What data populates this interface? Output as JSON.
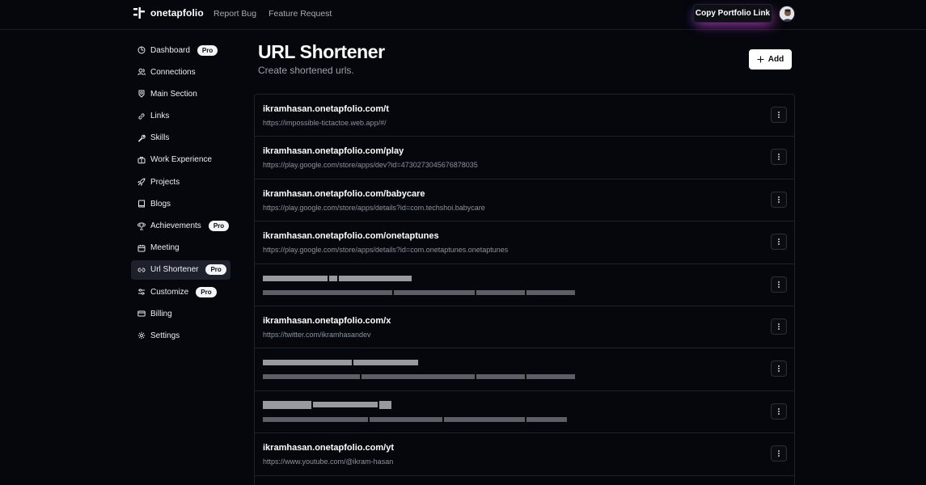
{
  "header": {
    "brand": "onetapfolio",
    "nav": [
      "Report Bug",
      "Feature Request"
    ],
    "copy_button": "Copy Portfolio Link",
    "accent_colors": [
      "#d63eba",
      "#604ad8"
    ]
  },
  "sidebar": {
    "items": [
      {
        "label": "Dashboard",
        "icon": "gauge-icon",
        "pro": true
      },
      {
        "label": "Connections",
        "icon": "users-icon",
        "pro": false
      },
      {
        "label": "Main Section",
        "icon": "badge-icon",
        "pro": false
      },
      {
        "label": "Links",
        "icon": "link-icon",
        "pro": false
      },
      {
        "label": "Skills",
        "icon": "wrench-icon",
        "pro": false
      },
      {
        "label": "Work Experience",
        "icon": "briefcase-icon",
        "pro": false
      },
      {
        "label": "Projects",
        "icon": "rocket-icon",
        "pro": false
      },
      {
        "label": "Blogs",
        "icon": "book-icon",
        "pro": false
      },
      {
        "label": "Achievements",
        "icon": "trophy-icon",
        "pro": true
      },
      {
        "label": "Meeting",
        "icon": "calendar-icon",
        "pro": false
      },
      {
        "label": "Url Shortener",
        "icon": "link-2-icon",
        "pro": true,
        "active": true
      },
      {
        "label": "Customize",
        "icon": "sliders-icon",
        "pro": true
      },
      {
        "label": "Billing",
        "icon": "credit-card-icon",
        "pro": false
      },
      {
        "label": "Settings",
        "icon": "gear-icon",
        "pro": false
      }
    ],
    "pro_label": "Pro"
  },
  "main": {
    "title": "URL Shortener",
    "subtitle": "Create shortened urls.",
    "add_label": "Add",
    "urls": [
      {
        "short": "ikramhasan.onetapfolio.com/t",
        "long": "https://impossible-tictactoe.web.app/#/"
      },
      {
        "short": "ikramhasan.onetapfolio.com/play",
        "long": "https://play.google.com/store/apps/dev?id=4730273045676878035"
      },
      {
        "short": "ikramhasan.onetapfolio.com/babycare",
        "long": "https://play.google.com/store/apps/details?id=com.techshoi.babycare"
      },
      {
        "short": "ikramhasan.onetapfolio.com/onetaptunes",
        "long": "https://play.google.com/store/apps/details?id=com.onetaptunes.onetaptunes"
      },
      {
        "short": "",
        "long": "",
        "redacted": true
      },
      {
        "short": "ikramhasan.onetapfolio.com/x",
        "long": "https://twitter.com/ikramhasandev"
      },
      {
        "short": "",
        "long": "",
        "redacted": true
      },
      {
        "short": "",
        "long": "",
        "redacted": true
      },
      {
        "short": "ikramhasan.onetapfolio.com/yt",
        "long": "https://www.youtube.com/@ikram-hasan"
      }
    ]
  }
}
